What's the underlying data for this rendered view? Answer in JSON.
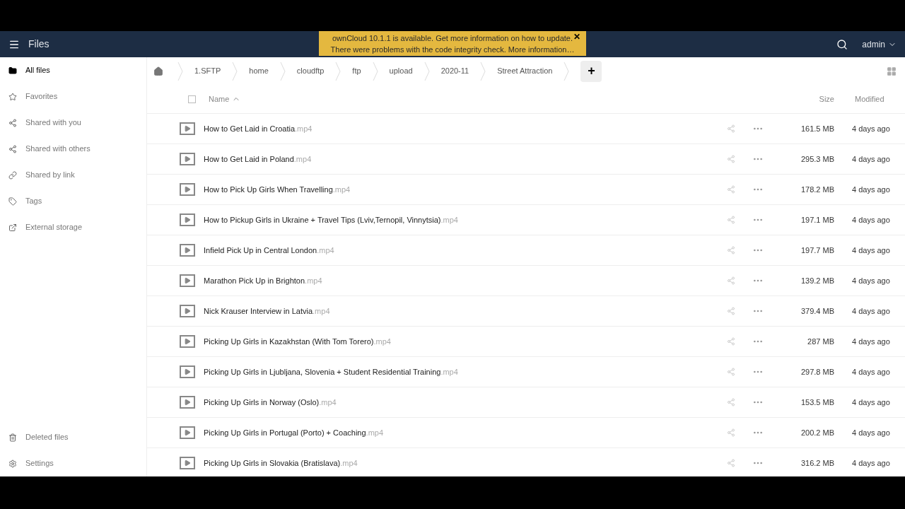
{
  "header": {
    "app_title": "Files",
    "user": "admin"
  },
  "notification": {
    "lines": [
      "ownCloud 10.1.1 is available. Get more information on how to update.",
      "There were problems with the code integrity check. More information…"
    ],
    "close": "✕"
  },
  "sidebar": {
    "items": [
      {
        "label": "All files",
        "selected": true
      },
      {
        "label": "Favorites",
        "selected": false
      },
      {
        "label": "Shared with you",
        "selected": false
      },
      {
        "label": "Shared with others",
        "selected": false
      },
      {
        "label": "Shared by link",
        "selected": false
      },
      {
        "label": "Tags",
        "selected": false
      },
      {
        "label": "External storage",
        "selected": false
      }
    ],
    "bottom": [
      {
        "label": "Deleted files"
      },
      {
        "label": "Settings"
      }
    ]
  },
  "breadcrumb": [
    "1.SFTP",
    "home",
    "cloudftp",
    "ftp",
    "upload",
    "2020-11",
    "Street Attraction"
  ],
  "new_button": "+",
  "table": {
    "select_all_checked": false,
    "columns": {
      "name": "Name",
      "size": "Size",
      "modified": "Modified"
    },
    "rows": [
      {
        "name": "How to Get Laid in Croatia",
        "ext": ".mp4",
        "size": "161.5 MB",
        "modified": "4 days ago"
      },
      {
        "name": "How to Get Laid in Poland",
        "ext": ".mp4",
        "size": "295.3 MB",
        "modified": "4 days ago"
      },
      {
        "name": "How to Pick Up Girls When Travelling",
        "ext": ".mp4",
        "size": "178.2 MB",
        "modified": "4 days ago"
      },
      {
        "name": "How to Pickup Girls in Ukraine + Travel Tips (Lviv,Ternopil, Vinnytsia)",
        "ext": ".mp4",
        "size": "197.1 MB",
        "modified": "4 days ago"
      },
      {
        "name": "Infield Pick Up in Central London",
        "ext": ".mp4",
        "size": "197.7 MB",
        "modified": "4 days ago"
      },
      {
        "name": "Marathon Pick Up in Brighton",
        "ext": ".mp4",
        "size": "139.2 MB",
        "modified": "4 days ago"
      },
      {
        "name": "Nick Krauser Interview in Latvia",
        "ext": ".mp4",
        "size": "379.4 MB",
        "modified": "4 days ago"
      },
      {
        "name": "Picking Up Girls in Kazakhstan (With Tom Torero)",
        "ext": ".mp4",
        "size": "287 MB",
        "modified": "4 days ago"
      },
      {
        "name": "Picking Up Girls in Ljubljana, Slovenia + Student Residential Training",
        "ext": ".mp4",
        "size": "297.8 MB",
        "modified": "4 days ago"
      },
      {
        "name": "Picking Up Girls in Norway (Oslo)",
        "ext": ".mp4",
        "size": "153.5 MB",
        "modified": "4 days ago"
      },
      {
        "name": "Picking Up Girls in Portugal (Porto) + Coaching",
        "ext": ".mp4",
        "size": "200.2 MB",
        "modified": "4 days ago"
      },
      {
        "name": "Picking Up Girls in Slovakia (Bratislava)",
        "ext": ".mp4",
        "size": "316.2 MB",
        "modified": "4 days ago"
      }
    ]
  }
}
